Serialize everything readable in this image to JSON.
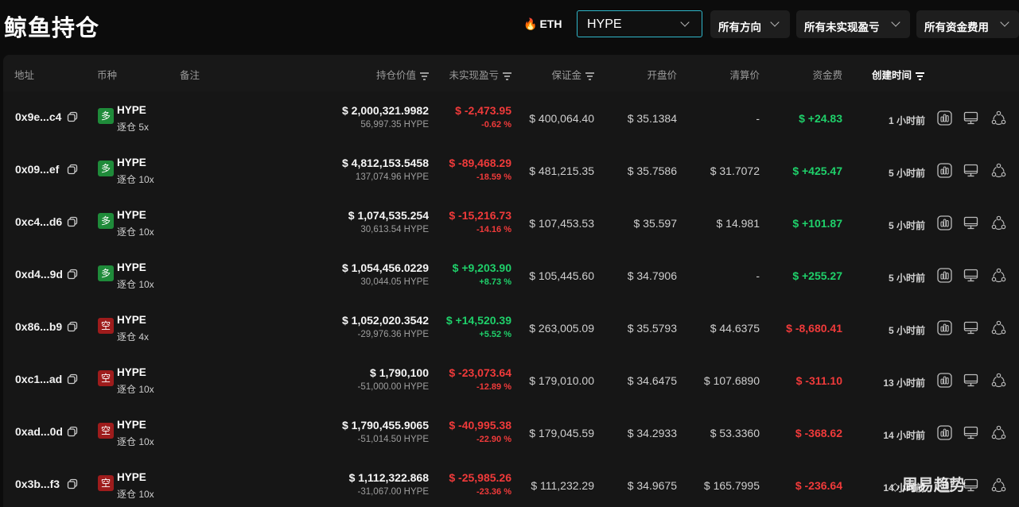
{
  "header": {
    "title": "鲸鱼持仓",
    "eth_label": "ETH",
    "coin_select_value": "HYPE",
    "filters": [
      "所有方向",
      "所有未实现盈亏",
      "所有资金费用"
    ]
  },
  "table": {
    "columns": {
      "address": "地址",
      "coin": "币种",
      "note": "备注",
      "position_value": "持仓价值",
      "unrealized_pnl": "未实现盈亏",
      "margin": "保证金",
      "open_price": "开盘价",
      "liq_price": "清算价",
      "funding": "资金费",
      "created": "创建时间"
    },
    "rows": [
      {
        "address": "0x9e...c4",
        "side": "多",
        "side_type": "long",
        "coin": "HYPE",
        "margin_mode": "逐仓 5x",
        "value": "$ 2,000,321.9982",
        "qty": "56,997.35 HYPE",
        "pnl": "$ -2,473.95",
        "pnl_pct": "-0.62 %",
        "pnl_sign": "neg",
        "margin": "$ 400,064.40",
        "open": "$ 35.1384",
        "liq": "-",
        "funding": "$ +24.83",
        "funding_sign": "pos",
        "time": "1 小时前"
      },
      {
        "address": "0x09...ef",
        "side": "多",
        "side_type": "long",
        "coin": "HYPE",
        "margin_mode": "逐仓 10x",
        "value": "$ 4,812,153.5458",
        "qty": "137,074.96 HYPE",
        "pnl": "$ -89,468.29",
        "pnl_pct": "-18.59 %",
        "pnl_sign": "neg",
        "margin": "$ 481,215.35",
        "open": "$ 35.7586",
        "liq": "$ 31.7072",
        "funding": "$ +425.47",
        "funding_sign": "pos",
        "time": "5 小时前"
      },
      {
        "address": "0xc4...d6",
        "side": "多",
        "side_type": "long",
        "coin": "HYPE",
        "margin_mode": "逐仓 10x",
        "value": "$ 1,074,535.254",
        "qty": "30,613.54 HYPE",
        "pnl": "$ -15,216.73",
        "pnl_pct": "-14.16 %",
        "pnl_sign": "neg",
        "margin": "$ 107,453.53",
        "open": "$ 35.597",
        "liq": "$ 14.981",
        "funding": "$ +101.87",
        "funding_sign": "pos",
        "time": "5 小时前"
      },
      {
        "address": "0xd4...9d",
        "side": "多",
        "side_type": "long",
        "coin": "HYPE",
        "margin_mode": "逐仓 10x",
        "value": "$ 1,054,456.0229",
        "qty": "30,044.05 HYPE",
        "pnl": "$ +9,203.90",
        "pnl_pct": "+8.73 %",
        "pnl_sign": "pos",
        "margin": "$ 105,445.60",
        "open": "$ 34.7906",
        "liq": "-",
        "funding": "$ +255.27",
        "funding_sign": "pos",
        "time": "5 小时前"
      },
      {
        "address": "0x86...b9",
        "side": "空",
        "side_type": "short",
        "coin": "HYPE",
        "margin_mode": "逐仓 4x",
        "value": "$ 1,052,020.3542",
        "qty": "-29,976.36 HYPE",
        "pnl": "$ +14,520.39",
        "pnl_pct": "+5.52 %",
        "pnl_sign": "pos",
        "margin": "$ 263,005.09",
        "open": "$ 35.5793",
        "liq": "$ 44.6375",
        "funding": "$ -8,680.41",
        "funding_sign": "neg",
        "time": "5 小时前"
      },
      {
        "address": "0xc1...ad",
        "side": "空",
        "side_type": "short",
        "coin": "HYPE",
        "margin_mode": "逐仓 10x",
        "value": "$ 1,790,100",
        "qty": "-51,000.00 HYPE",
        "pnl": "$ -23,073.64",
        "pnl_pct": "-12.89 %",
        "pnl_sign": "neg",
        "margin": "$ 179,010.00",
        "open": "$ 34.6475",
        "liq": "$ 107.6890",
        "funding": "$ -311.10",
        "funding_sign": "neg",
        "time": "13 小时前"
      },
      {
        "address": "0xad...0d",
        "side": "空",
        "side_type": "short",
        "coin": "HYPE",
        "margin_mode": "逐仓 10x",
        "value": "$ 1,790,455.9065",
        "qty": "-51,014.50 HYPE",
        "pnl": "$ -40,995.38",
        "pnl_pct": "-22.90 %",
        "pnl_sign": "neg",
        "margin": "$ 179,045.59",
        "open": "$ 34.2933",
        "liq": "$ 53.3360",
        "funding": "$ -368.62",
        "funding_sign": "neg",
        "time": "14 小时前"
      },
      {
        "address": "0x3b...f3",
        "side": "空",
        "side_type": "short",
        "coin": "HYPE",
        "margin_mode": "逐仓 10x",
        "value": "$ 1,112,322.868",
        "qty": "-31,067.00 HYPE",
        "pnl": "$ -25,985.26",
        "pnl_pct": "-23.36 %",
        "pnl_sign": "neg",
        "margin": "$ 111,232.29",
        "open": "$ 34.9675",
        "liq": "$ 165.7995",
        "funding": "$ -236.64",
        "funding_sign": "neg",
        "time": "14 小时前"
      }
    ]
  },
  "watermark": "周易趋势",
  "colors": {
    "positive": "#1fd06a",
    "negative": "#f03a3a",
    "long_badge": "#1f8b3a",
    "short_badge": "#9e1c1c",
    "select_border": "#2fb6c9"
  },
  "icons": [
    "fire-icon",
    "chevron-down-icon",
    "sort-icon",
    "copy-icon",
    "chart-icon",
    "monitor-icon",
    "share-icon"
  ]
}
